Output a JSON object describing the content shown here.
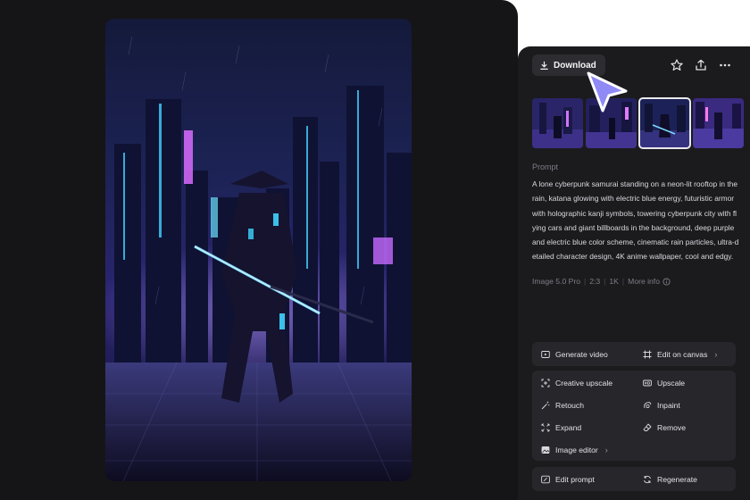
{
  "toolbar": {
    "download_label": "Download",
    "icons": [
      "download-icon",
      "star-icon",
      "share-icon",
      "more-icon"
    ]
  },
  "thumbnails": [
    {
      "name": "variation-1",
      "selected": false
    },
    {
      "name": "variation-2",
      "selected": false
    },
    {
      "name": "variation-3",
      "selected": true
    },
    {
      "name": "variation-4",
      "selected": false
    }
  ],
  "prompt": {
    "label": "Prompt",
    "text": "A lone cyberpunk samurai standing on a neon-lit rooftop in the rain, katana glowing with electric blue energy, futuristic armor with holographic kanji symbols, towering cyberpunk city with flying cars and giant billboards in the background, deep purple and electric blue color scheme, cinematic rain particles, ultra-detailed character design, 4K anime wallpaper, cool and edgy."
  },
  "meta": {
    "model": "Image 5.0 Pro",
    "ratio": "2:3",
    "resolution": "1K",
    "more_info": "More info"
  },
  "actions": {
    "generate_video": "Generate video",
    "edit_on_canvas": "Edit on canvas",
    "creative_upscale": "Creative upscale",
    "upscale": "Upscale",
    "retouch": "Retouch",
    "inpaint": "Inpaint",
    "expand": "Expand",
    "remove": "Remove",
    "image_editor": "Image editor",
    "edit_prompt": "Edit prompt",
    "regenerate": "Regenerate"
  },
  "colors": {
    "accent_cursor": "#8f8af5",
    "panel_dark": "#151517",
    "sidebar": "#1b1b1e",
    "card": "#27272b"
  }
}
